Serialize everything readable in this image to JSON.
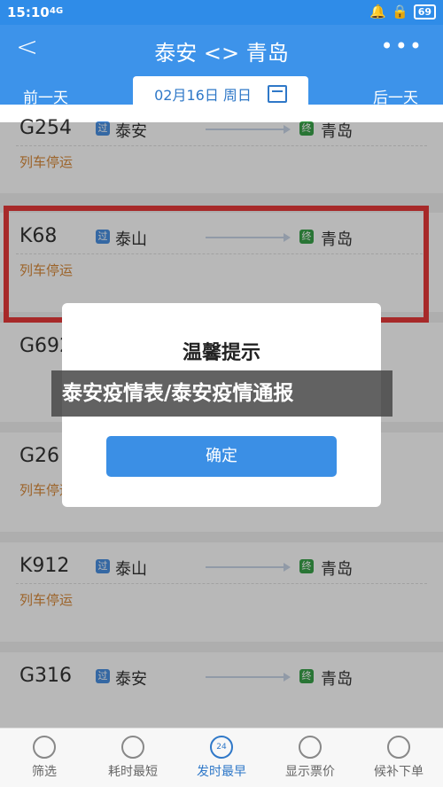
{
  "statusbar": {
    "time": "15:10",
    "signal": "4G",
    "battery": "69"
  },
  "header": {
    "title": "泰安 <> 青岛",
    "prev_day": "前一天",
    "next_day": "后一天",
    "date": "02月16日 周日"
  },
  "trains": [
    {
      "no": "G254",
      "from": "泰安",
      "to": "青岛",
      "status": "列车停运",
      "pass_tag": "过",
      "end_tag": "终"
    },
    {
      "no": "K68",
      "from": "泰山",
      "to": "青岛",
      "status": "列车停运",
      "pass_tag": "过",
      "end_tag": "终"
    },
    {
      "no": "G692",
      "from": "",
      "to": "",
      "status": "",
      "pass_tag": "",
      "end_tag": ""
    },
    {
      "no": "G26",
      "from": "",
      "to": "",
      "status": "列车停运",
      "pass_tag": "",
      "end_tag": ""
    },
    {
      "no": "K912",
      "from": "泰山",
      "to": "青岛",
      "status": "列车停运",
      "pass_tag": "过",
      "end_tag": "终"
    },
    {
      "no": "G316",
      "from": "泰安",
      "to": "青岛",
      "status": "",
      "pass_tag": "过",
      "end_tag": "终"
    }
  ],
  "dialog": {
    "title": "温馨提示",
    "ok": "确定"
  },
  "banner": {
    "text": "泰安疫情表/泰安疫情通报"
  },
  "tabbar": [
    {
      "label": "筛选",
      "icon": "filter-icon"
    },
    {
      "label": "耗时最短",
      "icon": "timer-icon"
    },
    {
      "label": "发时最早",
      "icon": "clock-24-icon"
    },
    {
      "label": "显示票价",
      "icon": "price-tag-icon"
    },
    {
      "label": "候补下单",
      "icon": "cart-icon"
    }
  ],
  "colors": {
    "header": "#3d93ea",
    "accent": "#2f78c8",
    "stopped": "#d98a3a",
    "highlight": "#e83a3a"
  }
}
